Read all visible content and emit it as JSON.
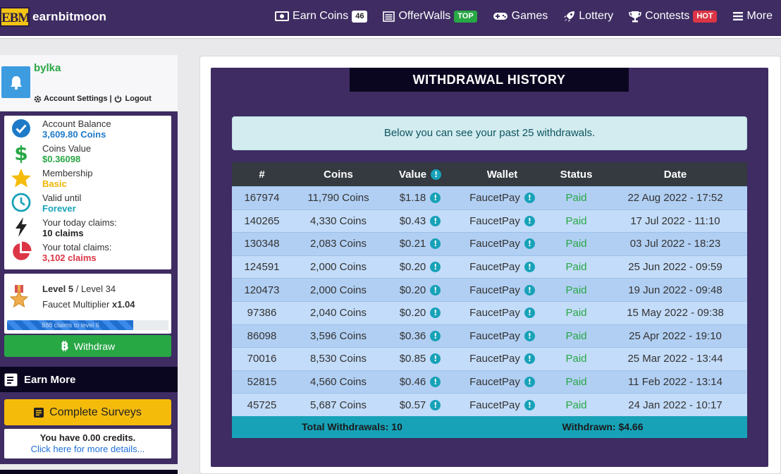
{
  "brand": {
    "logo_text": "EBM",
    "name": "earnbitmoon"
  },
  "nav": [
    {
      "label": "Earn Coins",
      "badge": "46",
      "icon": "money-icon"
    },
    {
      "label": "OfferWalls",
      "badge": "TOP",
      "icon": "list-icon"
    },
    {
      "label": "Games",
      "badge": "",
      "icon": "gamepad-icon"
    },
    {
      "label": "Lottery",
      "badge": "",
      "icon": "rocket-icon"
    },
    {
      "label": "Contests",
      "badge": "HOT",
      "icon": "trophy-icon"
    },
    {
      "label": "More",
      "badge": "",
      "icon": "menu-icon"
    }
  ],
  "user": {
    "username": "bylka",
    "account_settings": "Account Settings",
    "separator": "|",
    "logout": "Logout"
  },
  "stats": [
    {
      "label": "Account Balance",
      "value": "3,609.80 Coins",
      "color": "#1e7ac8"
    },
    {
      "label": "Coins Value",
      "value": "$0.36098",
      "color": "#28a745"
    },
    {
      "label": "Membership",
      "value": "Basic",
      "color": "#f0b400"
    },
    {
      "label": "Valid until",
      "value": "Forever",
      "color": "#17a2b8"
    },
    {
      "label": "Your today claims:",
      "value": "10 claims",
      "color": "#222222"
    },
    {
      "label": "Your total claims:",
      "value": "3,102 claims",
      "color": "#dc3545"
    }
  ],
  "level": {
    "current": "Level 5",
    "separator": " / ",
    "max": "Level 34",
    "multiplier_label": "Faucet Multiplier ",
    "multiplier_value": "x1.04",
    "progress_text": "888 claims to level 6",
    "progress_fraction": 0.78
  },
  "withdraw_label": "Withdraw",
  "earn_more": {
    "title": "Earn More",
    "surveys_label": "Complete Surveys",
    "credits_text": "You have 0.00 credits.",
    "credits_link": "Click here for more details..."
  },
  "history": {
    "title": "WITHDRAWAL HISTORY",
    "info": "Below you can see your past 25 withdrawals.",
    "columns": [
      "#",
      "Coins",
      "Value",
      "Wallet",
      "Status",
      "Date"
    ],
    "rows": [
      {
        "id": "167974",
        "coins": "11,790 Coins",
        "value": "$1.18",
        "wallet": "FaucetPay",
        "status": "Paid",
        "date": "22 Aug 2022 - 17:52"
      },
      {
        "id": "140265",
        "coins": "4,330 Coins",
        "value": "$0.43",
        "wallet": "FaucetPay",
        "status": "Paid",
        "date": "17 Jul 2022 - 11:10"
      },
      {
        "id": "130348",
        "coins": "2,083 Coins",
        "value": "$0.21",
        "wallet": "FaucetPay",
        "status": "Paid",
        "date": "03 Jul 2022 - 18:23"
      },
      {
        "id": "124591",
        "coins": "2,000 Coins",
        "value": "$0.20",
        "wallet": "FaucetPay",
        "status": "Paid",
        "date": "25 Jun 2022 - 09:59"
      },
      {
        "id": "120473",
        "coins": "2,000 Coins",
        "value": "$0.20",
        "wallet": "FaucetPay",
        "status": "Paid",
        "date": "19 Jun 2022 - 09:48"
      },
      {
        "id": "97386",
        "coins": "2,040 Coins",
        "value": "$0.20",
        "wallet": "FaucetPay",
        "status": "Paid",
        "date": "15 May 2022 - 09:38"
      },
      {
        "id": "86098",
        "coins": "3,596 Coins",
        "value": "$0.36",
        "wallet": "FaucetPay",
        "status": "Paid",
        "date": "25 Apr 2022 - 19:10"
      },
      {
        "id": "70016",
        "coins": "8,530 Coins",
        "value": "$0.85",
        "wallet": "FaucetPay",
        "status": "Paid",
        "date": "25 Mar 2022 - 13:44"
      },
      {
        "id": "52815",
        "coins": "4,560 Coins",
        "value": "$0.46",
        "wallet": "FaucetPay",
        "status": "Paid",
        "date": "11 Feb 2022 - 13:14"
      },
      {
        "id": "45725",
        "coins": "5,687 Coins",
        "value": "$0.57",
        "wallet": "FaucetPay",
        "status": "Paid",
        "date": "24 Jan 2022 - 10:17"
      }
    ],
    "total_label": "Total Withdrawals: 10",
    "withdrawn_label": "Withdrawn: $4.66"
  }
}
